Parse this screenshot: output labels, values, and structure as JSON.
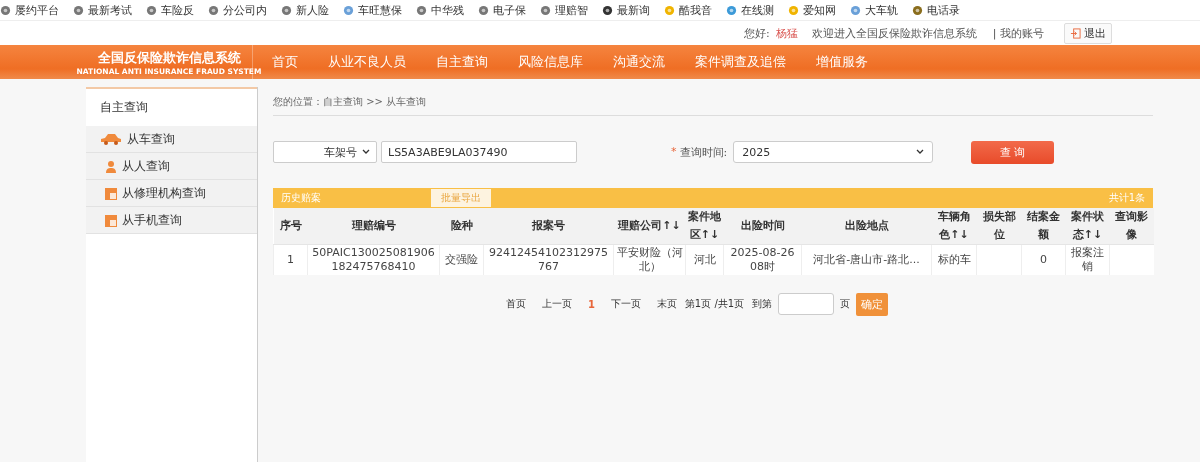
{
  "bookmarks": [
    "屡约平台",
    "最新考试",
    "车险反",
    "分公司内",
    "新人险",
    "车旺慧保",
    "中华残",
    "电子保",
    "理赔智",
    "最新询",
    "酷我音",
    "在线测",
    "爱知网",
    "大车轨",
    "电话录"
  ],
  "user_bar": {
    "greeting": "您好:",
    "user_name": "杨猛",
    "welcome": "欢迎进入全国反保险欺诈信息系统",
    "account": "| 我的账号",
    "logout": "退出"
  },
  "logo": {
    "title": "全国反保险欺诈信息系统",
    "subtitle": "NATIONAL ANTI INSURANCE FRAUD SYSTEM"
  },
  "nav": [
    "首页",
    "从业不良人员",
    "自主查询",
    "风险信息库",
    "沟通交流",
    "案件调查及追偿",
    "增值服务"
  ],
  "sidebar": {
    "title": "自主查询",
    "items": [
      {
        "label": "从车查询",
        "kind": "car"
      },
      {
        "label": "从人查询",
        "kind": "person"
      },
      {
        "label": "从修理机构查询",
        "kind": "folder"
      },
      {
        "label": "从手机查询",
        "kind": "folder"
      }
    ]
  },
  "breadcrumb": "您的位置：自主查询 >> 从车查询",
  "search": {
    "type_select": "车架号",
    "vin": "LS5A3ABE9LA037490",
    "required_mark": "*",
    "time_label": "查询时间:",
    "time_select": "2025",
    "button": "查 询"
  },
  "results": {
    "title": "历史赔案",
    "export": "批量导出",
    "total": "共计1条",
    "columns": [
      "序号",
      "理赔编号",
      "险种",
      "报案号",
      "理赔公司↑↓",
      "案件地区↑↓",
      "出险时间",
      "出险地点",
      "车辆角色↑↓",
      "损失部位",
      "结案金额",
      "案件状态↑↓",
      "查询影像"
    ],
    "rows": [
      [
        "1",
        "50PAIC130025081906182475768410",
        "交强险",
        "92412454102312975767",
        "平安财险（河北）",
        "河北",
        "2025-08-26 08时",
        "河北省-唐山市-路北...",
        "标的车",
        "",
        "0",
        "报案注销",
        ""
      ]
    ]
  },
  "pagination": {
    "links": [
      {
        "label": "首页",
        "selected": false
      },
      {
        "label": "上一页",
        "selected": false
      },
      {
        "label": "1",
        "selected": true
      },
      {
        "label": "下一页",
        "selected": false
      },
      {
        "label": "末页",
        "selected": false
      }
    ],
    "info": "第1页 /共1页",
    "goto": "到第",
    "unit": "页",
    "confirm": "确定"
  }
}
